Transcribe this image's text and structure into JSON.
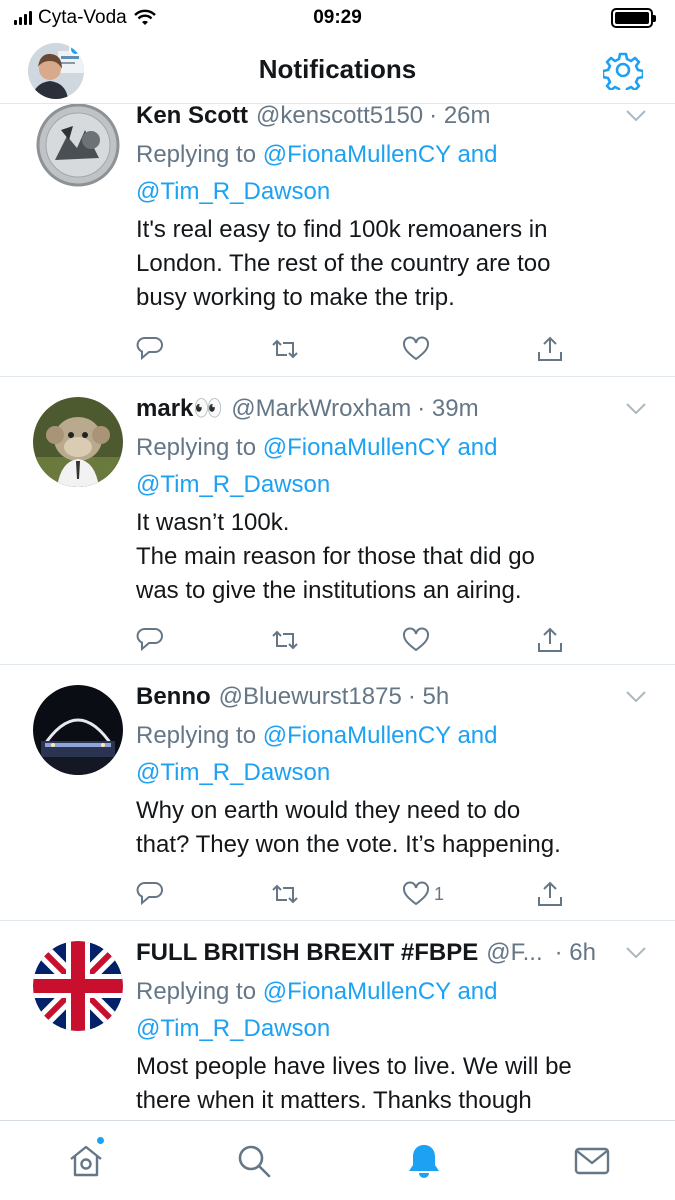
{
  "status_bar": {
    "carrier": "Cyta-Voda",
    "time": "09:29"
  },
  "header": {
    "title": "Notifications"
  },
  "tweets": [
    {
      "name": "Ken Scott",
      "handle": "@kenscott5150",
      "time": "· 26m",
      "replying_prefix": "Replying to",
      "mention_1": "@FionaMullenCY",
      "and": "and",
      "mention_2": "@Tim_R_Dawson",
      "text": "It's real easy to find 100k remoaners in\nLondon.  The rest of the country are too\nbusy working to make the trip.",
      "like_count": ""
    },
    {
      "name": "mark👀",
      "handle": "@MarkWroxham",
      "time": "· 39m",
      "replying_prefix": "Replying to",
      "mention_1": "@FionaMullenCY",
      "and": "and",
      "mention_2": "@Tim_R_Dawson",
      "text": "It wasn’t 100k.\nThe main reason for those that did go\nwas to give the institutions an airing.",
      "like_count": ""
    },
    {
      "name": "Benno",
      "handle": "@Bluewurst1875",
      "time": "· 5h",
      "replying_prefix": "Replying to",
      "mention_1": "@FionaMullenCY",
      "and": "and",
      "mention_2": "@Tim_R_Dawson",
      "text": "Why on earth would they need to do\nthat? They won the vote. It’s happening.",
      "like_count": "1"
    },
    {
      "name": "FULL BRITISH BREXIT #FBPE",
      "handle": "@F...",
      "time": "· 6h",
      "replying_prefix": "Replying to",
      "mention_1": "@FionaMullenCY",
      "and": "and",
      "mention_2": "@Tim_R_Dawson",
      "text": "Most people have lives to live. We will be\nthere when it matters. Thanks though",
      "like_count": ""
    }
  ],
  "icons": {
    "chevron": "chevron-down-icon",
    "reply": "reply-icon",
    "retweet": "retweet-icon",
    "like": "heart-icon",
    "share": "share-icon",
    "settings": "gear-icon",
    "tabs": [
      "home-icon",
      "search-icon",
      "notifications-bell-icon",
      "messages-icon"
    ]
  },
  "colors": {
    "accent": "#1da1f2",
    "secondary_text": "#657786",
    "primary_text": "#14171a",
    "divider": "#e1e8ed"
  }
}
